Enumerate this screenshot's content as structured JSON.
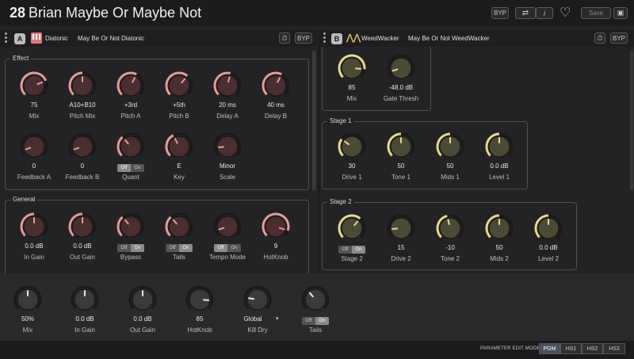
{
  "header": {
    "preset_number": "28",
    "preset_name": "Brian Maybe Or Maybe Not",
    "byp": "BYP",
    "save": "Save"
  },
  "blockA": {
    "letter": "A",
    "type": "Diatonic",
    "name": "May Be Or Not Diatonic",
    "byp": "BYP"
  },
  "blockB": {
    "letter": "B",
    "type": "WeedWacker",
    "name": "May Be Or Not WeedWacker",
    "byp": "BYP"
  },
  "effect": {
    "title": "Effect",
    "knobs": [
      {
        "value": "75",
        "label": "Mix",
        "level": 0.75,
        "color": "#e89a9a"
      },
      {
        "value": "A10+B10",
        "label": "Pitch Mix",
        "level": 0.5,
        "color": "#e89a9a"
      },
      {
        "value": "+3rd",
        "label": "Pitch A",
        "level": 0.6,
        "color": "#e89a9a"
      },
      {
        "value": "+5th",
        "label": "Pitch B",
        "level": 0.65,
        "color": "#e89a9a"
      },
      {
        "value": "20 ms",
        "label": "Delay A",
        "level": 0.55,
        "color": "#e89a9a"
      },
      {
        "value": "40 ms",
        "label": "Delay B",
        "level": 0.6,
        "color": "#e89a9a"
      },
      {
        "value": "0",
        "label": "Feedback A",
        "level": 0.1,
        "color": "#e89a9a"
      },
      {
        "value": "0",
        "label": "Feedback B",
        "level": 0.1,
        "color": "#e89a9a"
      },
      {
        "value": "",
        "label": "Quant",
        "level": 0.35,
        "color": "#e89a9a",
        "toggle": {
          "off": "Off",
          "on": "On",
          "state": "off"
        }
      },
      {
        "value": "E",
        "label": "Key",
        "level": 0.4,
        "color": "#e89a9a"
      },
      {
        "value": "Minor",
        "label": "Scale",
        "level": 0.15,
        "color": "#e89a9a"
      }
    ]
  },
  "general": {
    "title": "General",
    "knobs": [
      {
        "value": "0.0 dB",
        "label": "In Gain",
        "level": 0.5,
        "color": "#e89a9a"
      },
      {
        "value": "0.0 dB",
        "label": "Out Gain",
        "level": 0.5,
        "color": "#e89a9a"
      },
      {
        "value": "",
        "label": "Bypass",
        "level": 0.35,
        "color": "#e89a9a",
        "toggle": {
          "off": "Off",
          "on": "On",
          "state": "on"
        }
      },
      {
        "value": "",
        "label": "Tails",
        "level": 0.35,
        "color": "#e89a9a",
        "toggle": {
          "off": "Off",
          "on": "On",
          "state": "on"
        }
      },
      {
        "value": "",
        "label": "Tempo Mode",
        "level": 0.1,
        "color": "#e89a9a",
        "toggle": {
          "off": "Off",
          "on": "On",
          "state": "off"
        }
      },
      {
        "value": "9",
        "label": "HotKnob",
        "level": 0.9,
        "color": "#e89a9a"
      }
    ]
  },
  "top": {
    "knobs": [
      {
        "value": "85",
        "label": "Mix",
        "level": 0.85,
        "color": "#e8d98a"
      },
      {
        "value": "-48.0 dB",
        "label": "Gate Thresh",
        "level": 0.1,
        "color": "#e8d98a"
      }
    ]
  },
  "stage1": {
    "title": "Stage 1",
    "knobs": [
      {
        "value": "30",
        "label": "Drive 1",
        "level": 0.3,
        "color": "#e8d98a"
      },
      {
        "value": "50",
        "label": "Tone 1",
        "level": 0.5,
        "color": "#e8d98a"
      },
      {
        "value": "50",
        "label": "Mids 1",
        "level": 0.5,
        "color": "#e8d98a"
      },
      {
        "value": "0.0 dB",
        "label": "Level 1",
        "level": 0.5,
        "color": "#e8d98a"
      }
    ]
  },
  "stage2": {
    "title": "Stage 2",
    "knobs": [
      {
        "value": "",
        "label": "Stage 2",
        "level": 0.65,
        "color": "#e8d98a",
        "toggle": {
          "off": "Off",
          "on": "On",
          "state": "on"
        }
      },
      {
        "value": "15",
        "label": "Drive 2",
        "level": 0.15,
        "color": "#e8d98a"
      },
      {
        "value": "-10",
        "label": "Tone 2",
        "level": 0.45,
        "color": "#e8d98a"
      },
      {
        "value": "50",
        "label": "Mids 2",
        "level": 0.5,
        "color": "#e8d98a"
      },
      {
        "value": "0.0 dB",
        "label": "Level 2",
        "level": 0.5,
        "color": "#e8d98a"
      }
    ]
  },
  "global": {
    "knobs": [
      {
        "value": "50%",
        "label": "Mix",
        "level": 0.5,
        "color": "#bbbbbb"
      },
      {
        "value": "0.0 dB",
        "label": "In Gain",
        "level": 0.5,
        "color": "#bbbbbb"
      },
      {
        "value": "0.0 dB",
        "label": "Out Gain",
        "level": 0.5,
        "color": "#bbbbbb"
      },
      {
        "value": "85",
        "label": "HotKnob",
        "level": 0.85,
        "color": "#bbbbbb"
      },
      {
        "value": "Global",
        "label": "Kill Dry",
        "level": 0.2,
        "color": "#bbbbbb",
        "dropdown": true
      },
      {
        "value": "",
        "label": "Tails",
        "level": 0.35,
        "color": "#bbbbbb",
        "toggle": {
          "off": "Off",
          "on": "On",
          "state": "on"
        }
      }
    ]
  },
  "footer": {
    "mode_label": "PARAMETER EDIT MODE",
    "modes": [
      "PGM",
      "HS1",
      "HS2",
      "HS3"
    ],
    "selected": 0
  }
}
